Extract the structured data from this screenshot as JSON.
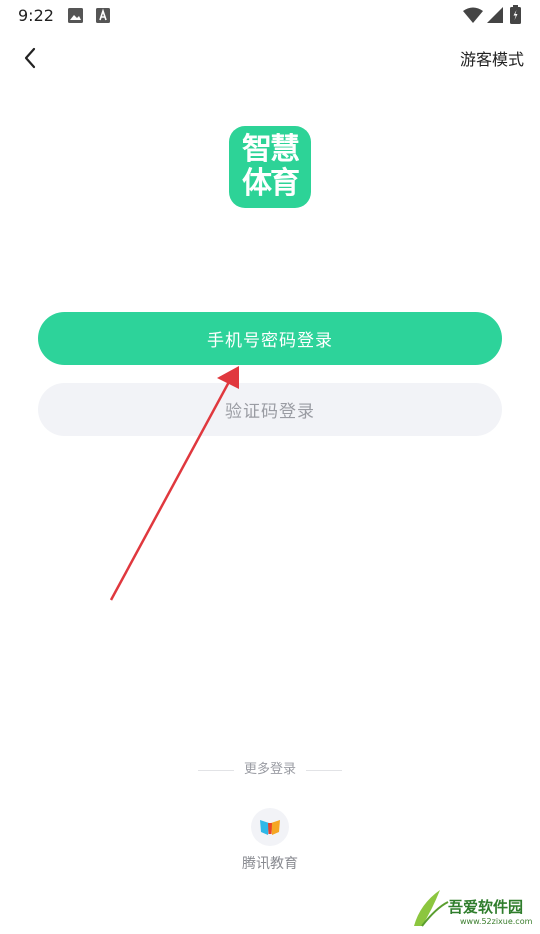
{
  "status_bar": {
    "time": "9:22",
    "icons": [
      "image-icon",
      "accessibility-icon",
      "wifi-icon",
      "signal-icon",
      "battery-icon"
    ]
  },
  "header": {
    "back_icon": "chevron-left-icon",
    "guest_mode_label": "游客模式"
  },
  "logo": {
    "line1": "智慧",
    "line2": "体育",
    "color": "#2dd397"
  },
  "login": {
    "password_login_label": "手机号密码登录",
    "sms_login_label": "验证码登录"
  },
  "more_login": {
    "label": "更多登录",
    "providers": [
      {
        "label": "腾讯教育",
        "icon": "tencent-education-icon"
      }
    ]
  },
  "watermark": {
    "text": "吾爱软件园",
    "url": "www.52zixue.com"
  },
  "colors": {
    "primary": "#2dd39a",
    "secondary_bg": "#f2f3f7",
    "secondary_text": "#9a9ca3",
    "annotation": "#e0383e"
  }
}
